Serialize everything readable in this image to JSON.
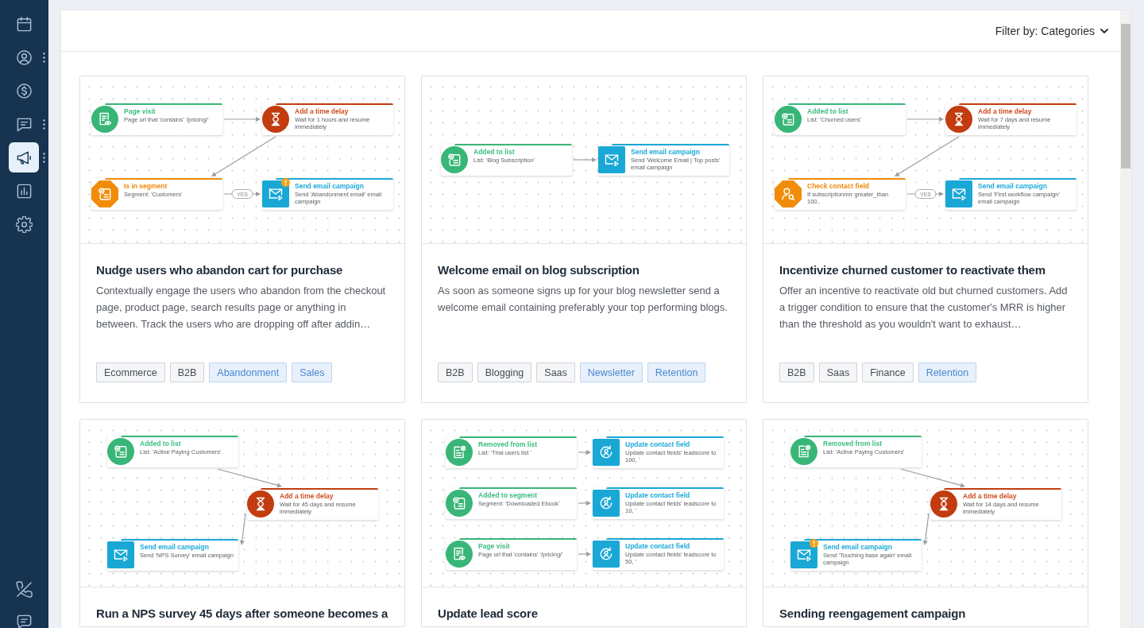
{
  "sidebar": {
    "items": [
      {
        "kind": "calendar",
        "selected": false,
        "menu": false
      },
      {
        "kind": "contacts",
        "selected": false,
        "menu": true
      },
      {
        "kind": "deals",
        "selected": false,
        "menu": false
      },
      {
        "kind": "conversations",
        "selected": false,
        "menu": true
      },
      {
        "kind": "campaigns",
        "selected": true,
        "menu": true
      },
      {
        "kind": "reports",
        "selected": false,
        "menu": false
      },
      {
        "kind": "settings",
        "selected": false,
        "menu": false
      }
    ],
    "bottom_items": [
      {
        "kind": "phone",
        "selected": false
      },
      {
        "kind": "chat",
        "selected": false
      }
    ]
  },
  "header": {
    "filter_label": "Filter by: Categories"
  },
  "templates": [
    {
      "title": "Nudge users who abandon cart for purchase",
      "description": "Contextually engage the users who abandon from the checkout page, product page, search results page or anything in between. Track the users who are dropping off after addin…",
      "tags": [
        {
          "label": "Ecommerce",
          "highlighted": false
        },
        {
          "label": "B2B",
          "highlighted": false
        },
        {
          "label": "Abandonment",
          "highlighted": true
        },
        {
          "label": "Sales",
          "highlighted": true
        }
      ],
      "workflow": {
        "chains": [
          {
            "steps": [
              {
                "kind": "page_visit",
                "title": "Page visit",
                "detail": "Page url that 'contains' '/pricing/'",
                "warning": false
              },
              {
                "kind": "delay",
                "title": "Add a time delay",
                "detail": "Wait for 1 hours and resume immediately",
                "warning": false
              },
              {
                "kind": "segment_check",
                "title": "Is in segment",
                "detail": "Segment: 'Customers'",
                "warning": false
              },
              {
                "kind": "email",
                "title": "Send email campaign",
                "detail": "Send 'Abandonment email' email campaign",
                "warning": true,
                "edge_label": "YES"
              }
            ]
          }
        ]
      }
    },
    {
      "title": "Welcome email on blog subscription",
      "description": "As soon as someone signs up for your blog newsletter send a welcome email containing preferably your top performing blogs.",
      "tags": [
        {
          "label": "B2B",
          "highlighted": false
        },
        {
          "label": "Blogging",
          "highlighted": false
        },
        {
          "label": "Saas",
          "highlighted": false
        },
        {
          "label": "Newsletter",
          "highlighted": true
        },
        {
          "label": "Retention",
          "highlighted": true
        }
      ],
      "workflow": {
        "chains": [
          {
            "steps": [
              {
                "kind": "list_added",
                "title": "Added to list",
                "detail": "List: 'Blog Subscription'",
                "warning": false
              },
              {
                "kind": "email",
                "title": "Send email campaign",
                "detail": "Send 'Welcome Email | Top posts' email campaign",
                "warning": false
              }
            ]
          }
        ]
      }
    },
    {
      "title": "Incentivize churned customer to reactivate them",
      "description": "Offer an incentive to reactivate old but churned customers. Add a trigger condition to ensure that the customer's MRR is higher than the threshold as you wouldn't want to exhaust…",
      "tags": [
        {
          "label": "B2B",
          "highlighted": false
        },
        {
          "label": "Saas",
          "highlighted": false
        },
        {
          "label": "Finance",
          "highlighted": false
        },
        {
          "label": "Retention",
          "highlighted": true
        }
      ],
      "workflow": {
        "chains": [
          {
            "steps": [
              {
                "kind": "list_added",
                "title": "Added to list",
                "detail": "List: 'Churned users'",
                "warning": false
              },
              {
                "kind": "delay",
                "title": "Add a time delay",
                "detail": "Wait for 7 days and resume immediately",
                "warning": false
              },
              {
                "kind": "contact_check",
                "title": "Check contact field",
                "detail": "If subscriptionmrr greater_than 100..",
                "warning": false
              },
              {
                "kind": "email",
                "title": "Send email campaign",
                "detail": "Send 'First workflow campaign' email campaign",
                "warning": false,
                "edge_label": "YES"
              }
            ]
          }
        ]
      }
    },
    {
      "title": "Run a NPS survey 45 days after someone becomes a",
      "workflow": {
        "chains": [
          {
            "steps": [
              {
                "kind": "list_added",
                "title": "Added to list",
                "detail": "List: 'Active Paying Customers'",
                "warning": false
              },
              {
                "kind": "delay",
                "title": "Add a time delay",
                "detail": "Wait for 45 days and resume immediately",
                "warning": false
              },
              {
                "kind": "email",
                "title": "Send email campaign",
                "detail": "Send 'NPS Survey' email campaign",
                "warning": false
              }
            ]
          }
        ]
      }
    },
    {
      "title": "Update lead score",
      "workflow": {
        "chains": [
          {
            "steps": [
              {
                "kind": "list_removed",
                "title": "Removed from list",
                "detail": "List: 'Trial users list '",
                "warning": false
              },
              {
                "kind": "contact_update",
                "title": "Update contact field",
                "detail": "Update contact fields' leadscore to 100, '",
                "warning": false
              }
            ]
          },
          {
            "steps": [
              {
                "kind": "segment_added",
                "title": "Added to segment",
                "detail": "Segment: 'Downloaded Ebook'",
                "warning": false
              },
              {
                "kind": "contact_update",
                "title": "Update contact field",
                "detail": "Update contact fields' leadscore to 10, '",
                "warning": false
              }
            ]
          },
          {
            "steps": [
              {
                "kind": "page_visit",
                "title": "Page visit",
                "detail": "Page url that 'contains' '/pricing/'",
                "warning": false
              },
              {
                "kind": "contact_update",
                "title": "Update contact field",
                "detail": "Update contact fields' leadscore to 50, '",
                "warning": false
              }
            ]
          }
        ]
      }
    },
    {
      "title": "Sending reengagement campaign",
      "workflow": {
        "chains": [
          {
            "steps": [
              {
                "kind": "list_removed",
                "title": "Removed from list",
                "detail": "List: 'Active Paying Customers'",
                "warning": false
              },
              {
                "kind": "delay",
                "title": "Add a time delay",
                "detail": "Wait for 14 days and resume immediately",
                "warning": false
              },
              {
                "kind": "email",
                "title": "Send email campaign",
                "detail": "Send 'Touching base again' email campaign",
                "warning": true
              }
            ]
          }
        ]
      }
    }
  ]
}
